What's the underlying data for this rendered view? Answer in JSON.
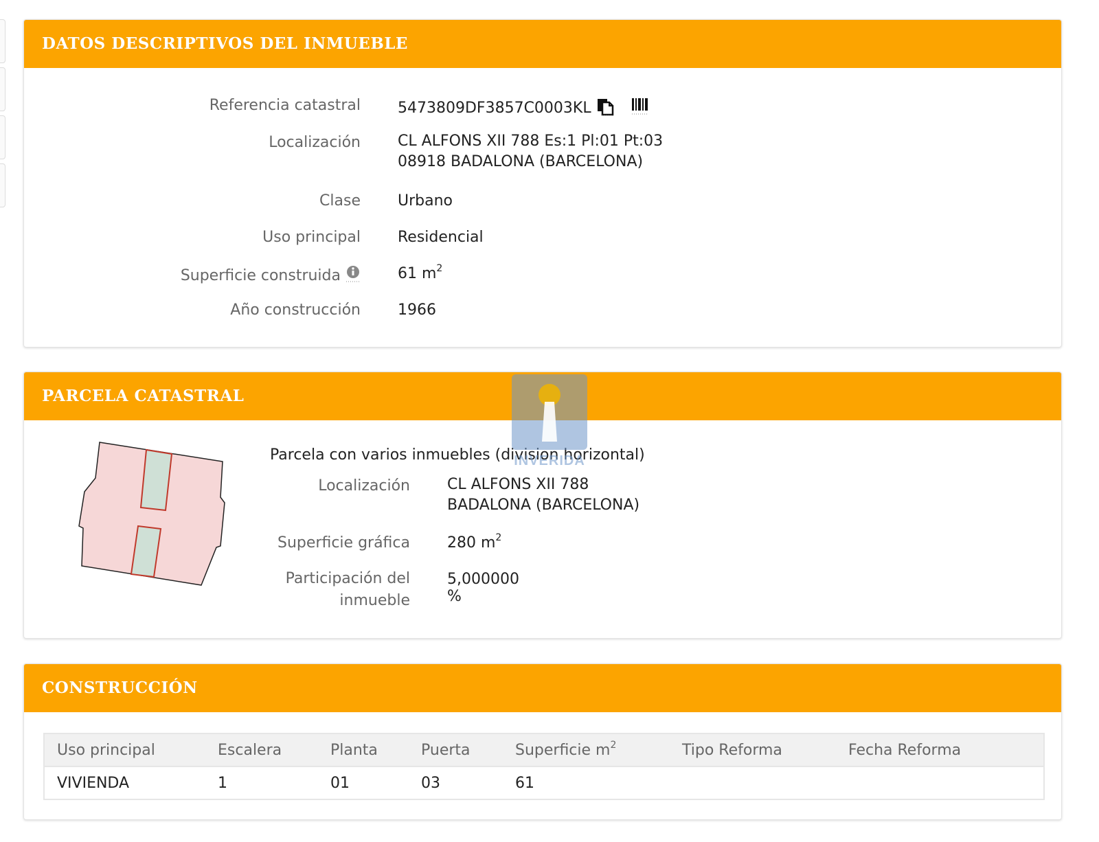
{
  "datos": {
    "title": "DATOS DESCRIPTIVOS DEL INMUEBLE",
    "referencia": {
      "label": "Referencia catastral",
      "value": "5473809DF3857C0003KL"
    },
    "localizacion": {
      "label": "Localización",
      "line1": "CL ALFONS XII 788 Es:1 Pl:01 Pt:03",
      "line2": "08918 BADALONA (BARCELONA)"
    },
    "clase": {
      "label": "Clase",
      "value": "Urbano"
    },
    "uso": {
      "label": "Uso principal",
      "value": "Residencial"
    },
    "superficie": {
      "label": "Superficie construida",
      "value": "61 m",
      "unit_sup": "2"
    },
    "anio": {
      "label": "Año construcción",
      "value": "1966"
    }
  },
  "parcela": {
    "title": "PARCELA CATASTRAL",
    "description": "Parcela con varios inmuebles (division horizontal)",
    "localizacion": {
      "label": "Localización",
      "line1": "CL ALFONS XII 788",
      "line2": "BADALONA (BARCELONA)"
    },
    "superficie": {
      "label": "Superficie gráfica",
      "value": "280 m",
      "unit_sup": "2"
    },
    "participacion": {
      "label_line1": "Participación del",
      "label_line2": "inmueble",
      "value": "5,000000 %"
    }
  },
  "construccion": {
    "title": "CONSTRUCCIÓN",
    "headers": [
      "Uso principal",
      "Escalera",
      "Planta",
      "Puerta",
      "Superficie m",
      "Tipo Reforma",
      "Fecha Reforma"
    ],
    "superficie_header_sup": "2",
    "rows": [
      [
        "VIVIENDA",
        "1",
        "01",
        "03",
        "61",
        "",
        ""
      ]
    ]
  },
  "watermark": {
    "text": "INVERIDA"
  },
  "colors": {
    "header_orange": "#fca400",
    "label_gray": "#666666",
    "parcel_fill": "#f6d7d7",
    "patio_fill": "#cfe0d6"
  },
  "icons": [
    "copy-icon",
    "barcode-icon",
    "info-icon",
    "parcel-map"
  ]
}
